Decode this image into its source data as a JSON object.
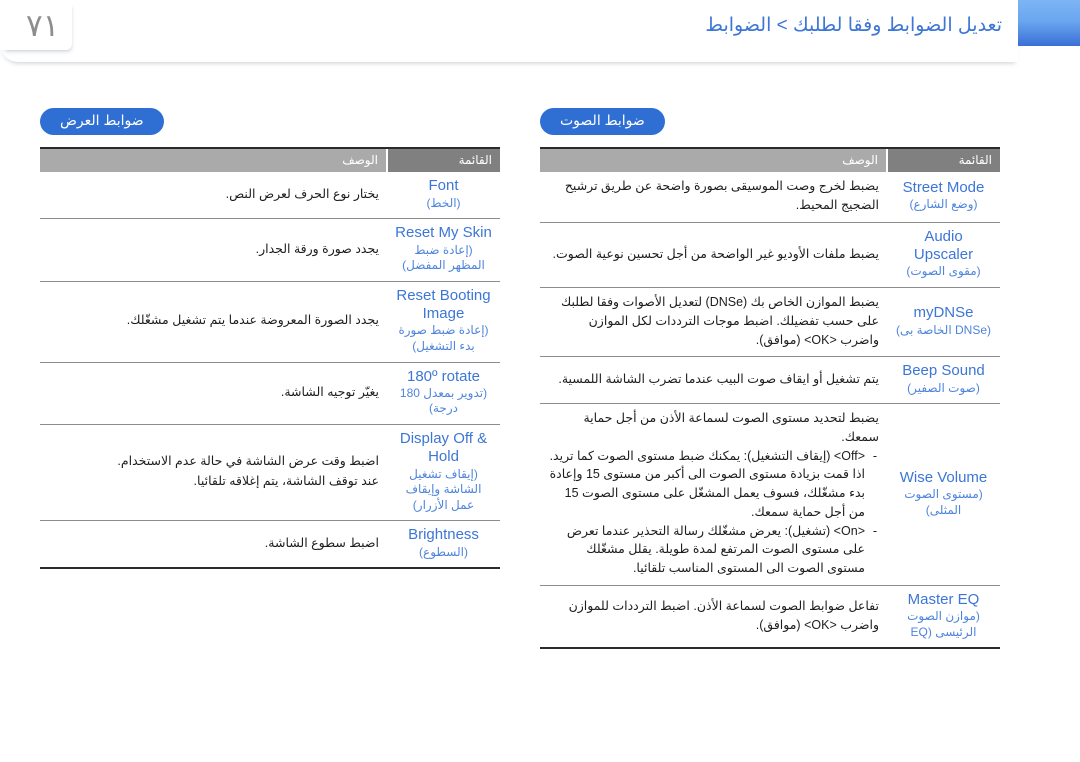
{
  "page": {
    "number": "٧١",
    "title": "تعديل الضوابط وفقا لطلبك > الضوابط",
    "accent_blue": "#3c76d6",
    "badge_blue": "#2f6fd4",
    "header_gray_menu": "#808080",
    "header_gray_desc": "#aaaaaa"
  },
  "sections": {
    "display": {
      "badge": "ضوابط العرض",
      "columns": {
        "menu": "القائمة",
        "description": "الوصف"
      },
      "rows": [
        {
          "menu_en": "Font",
          "menu_ar": "(الخط)",
          "desc": [
            "يختار نوع الحرف لعرض النص."
          ]
        },
        {
          "menu_en": "Reset My Skin",
          "menu_ar": "(إعادة ضبط المظهر المفضل)",
          "desc": [
            "يجدد صورة ورقة الجدار."
          ]
        },
        {
          "menu_en": "Reset Booting Image",
          "menu_ar": "(إعادة ضبط صورة بدء التشغيل)",
          "desc": [
            "يجدد الصورة المعروضة عندما يتم تشغيل مشغّلك."
          ]
        },
        {
          "menu_en": "180º rotate",
          "menu_ar": "(تدوير بمعدل 180 درجة)",
          "desc": [
            "يغيّر توجيه الشاشة."
          ]
        },
        {
          "menu_en": "Display Off & Hold",
          "menu_ar": "(إيقاف تشغيل الشاشة وإيقاف عمل الأزرار)",
          "desc": [
            "اضبط وقت عرض الشاشة في حالة عدم الاستخدام.",
            "عند توقف الشاشة، يتم إغلاقه تلقائيا."
          ]
        },
        {
          "menu_en": "Brightness",
          "menu_ar": "(السطوع)",
          "desc": [
            "اضبط سطوع الشاشة."
          ]
        }
      ]
    },
    "sound": {
      "badge": "ضوابط الصوت",
      "columns": {
        "menu": "القائمة",
        "description": "الوصف"
      },
      "rows": [
        {
          "menu_en": "Street Mode",
          "menu_ar": "(وضع الشارع)",
          "desc": [
            "يضبط لخرج وصت الموسيقى بصورة واضحة عن طريق ترشيح الضجيج المحيط."
          ]
        },
        {
          "menu_en": "Audio Upscaler",
          "menu_ar": "(مقوى الصوت)",
          "desc": [
            "يضبط ملفات الأوديو غير الواضحة من أجل تحسين نوعية الصوت."
          ]
        },
        {
          "menu_en": "myDNSe",
          "menu_ar": "(DNSe الخاصة بى)",
          "desc": [
            "يضبط الموازن الخاص بك (DNSe) لتعديل الأصوات وفقا لطلبك على حسب تفضيلك. اضبط موجات الترددات لكل الموازن واضرب <OK> (موافق)."
          ]
        },
        {
          "menu_en": "Beep Sound",
          "menu_ar": "(صوت الصفير)",
          "desc": [
            "يتم تشغيل أو ايقاف صوت البيب عندما تضرب الشاشة اللمسية."
          ]
        },
        {
          "menu_en": "Wise Volume",
          "menu_ar": "(مستوى الصوت المثلى)",
          "desc": [
            "يضبط لتحديد مستوى الصوت لسماعة الأذن من أجل حماية سمعك."
          ],
          "bullets": [
            "<Off> (إيقاف التشغيل): يمكنك ضبط مستوى الصوت كما تريد. اذا قمت بزيادة مستوى الصوت الى أكبر من مستوى 15 وإعادة بدء مشغّلك، فسوف يعمل المشغّل على مستوى الصوت 15 من أجل حماية سمعك.",
            "<On> (تشغيل): يعرض مشغّلك رسالة التحذير عندما تعرض على مستوى الصوت المرتفع لمدة طويلة. يقلل مشغّلك مستوى الصوت الى المستوى المناسب تلقائيا."
          ]
        },
        {
          "menu_en": "Master EQ",
          "menu_ar": "(موازن الصوت الرئيسى (EQ",
          "desc": [
            "تفاعل ضوابط الصوت لسماعة الأذن. اضبط الترددات للموازن واضرب <OK> (موافق)."
          ]
        }
      ]
    }
  }
}
